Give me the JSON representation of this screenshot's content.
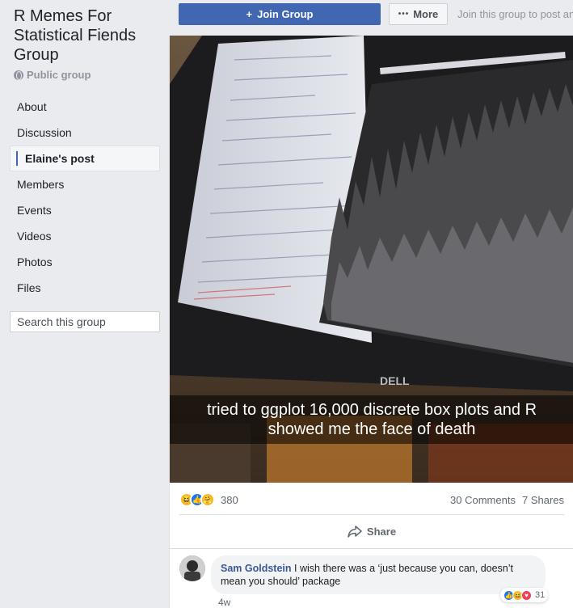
{
  "group": {
    "title": "R Memes For Statistical Fiends Group",
    "privacy": "Public group"
  },
  "nav": {
    "items": [
      {
        "label": "About"
      },
      {
        "label": "Discussion"
      },
      {
        "label": "Elaine's post"
      },
      {
        "label": "Members"
      },
      {
        "label": "Events"
      },
      {
        "label": "Videos"
      },
      {
        "label": "Photos"
      },
      {
        "label": "Files"
      }
    ],
    "active_index": 2
  },
  "search": {
    "placeholder": "Search this group"
  },
  "topbar": {
    "join_label": "Join Group",
    "more_label": "More",
    "join_hint": "Join this group to post and comment."
  },
  "post": {
    "caption_line1": "tried to ggplot 16,000 discrete box plots and R",
    "caption_line2": "showed me the face of death",
    "reaction_count": "380",
    "comments_count": "30 Comments",
    "shares_count": "7 Shares",
    "share_label": "Share"
  },
  "comment": {
    "author": "Sam Goldstein",
    "text": "I wish there was a ‘just because you can, doesn’t mean you should’ package",
    "time": "4w",
    "reaction_count": "31"
  },
  "colors": {
    "brand_blue": "#4267b2",
    "link_blue": "#385898",
    "background": "#e9ebee"
  },
  "icons": {
    "privacy": "globe-icon",
    "join": "plus-icon",
    "more": "ellipsis-icon",
    "search": "search-icon",
    "share": "share-arrow-icon"
  }
}
